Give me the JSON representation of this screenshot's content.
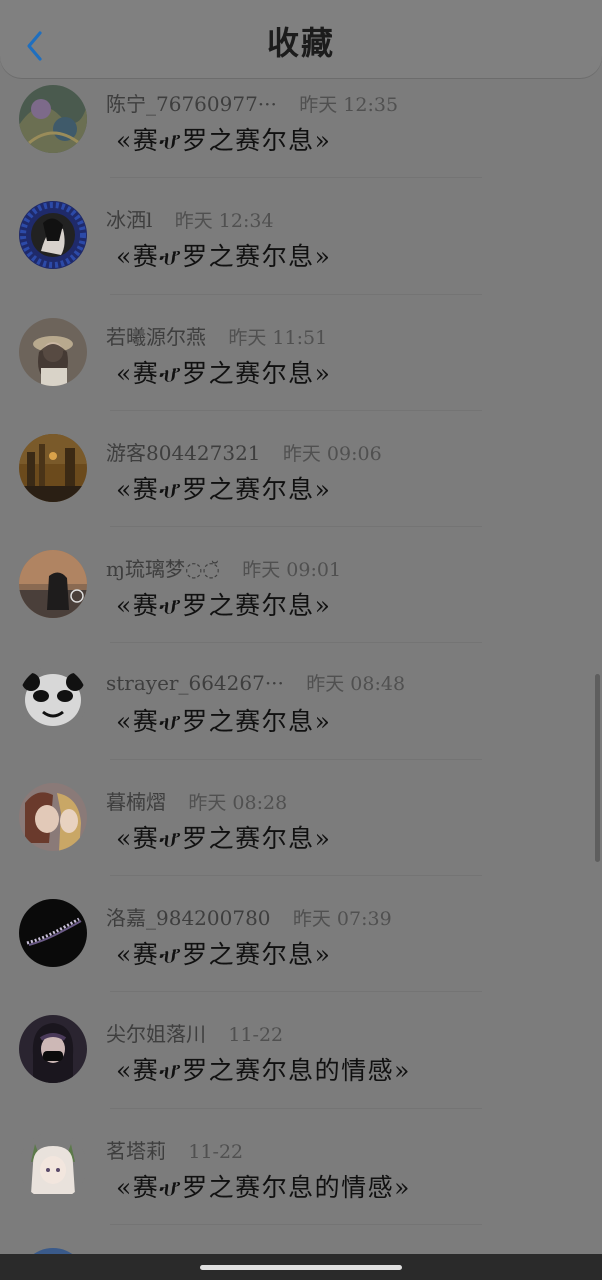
{
  "header": {
    "title": "收藏",
    "back_icon": "chevron-left-icon",
    "back_color": "#1f6fbf"
  },
  "items": [
    {
      "name": "陈宁_76760977···",
      "time": "昨天 12:35",
      "message": "«赛ሇ罗之赛尔息»"
    },
    {
      "name": "冰洒l",
      "time": "昨天 12:34",
      "message": "«赛ሇ罗之赛尔息»"
    },
    {
      "name": "若曦源尔燕",
      "time": "昨天 11:51",
      "message": "«赛ሇ罗之赛尔息»"
    },
    {
      "name": "游客804427321",
      "time": "昨天 09:06",
      "message": "«赛ሇ罗之赛尔息»"
    },
    {
      "name": "ɱ琉璃梦◌◌̆",
      "time": "昨天 09:01",
      "message": "«赛ሇ罗之赛尔息»"
    },
    {
      "name": "strayer_664267···",
      "time": "昨天 08:48",
      "message": "«赛ሇ罗之赛尔息»"
    },
    {
      "name": "暮楠熠",
      "time": "昨天 08:28",
      "message": "«赛ሇ罗之赛尔息»"
    },
    {
      "name": "洛嘉_984200780",
      "time": "昨天 07:39",
      "message": "«赛ሇ罗之赛尔息»"
    },
    {
      "name": "尖尔姐落川",
      "time": "11-22",
      "message": "«赛ሇ罗之赛尔息的情感»"
    },
    {
      "name": "茗塔莉",
      "time": "11-22",
      "message": "«赛ሇ罗之赛尔息的情感»"
    }
  ]
}
